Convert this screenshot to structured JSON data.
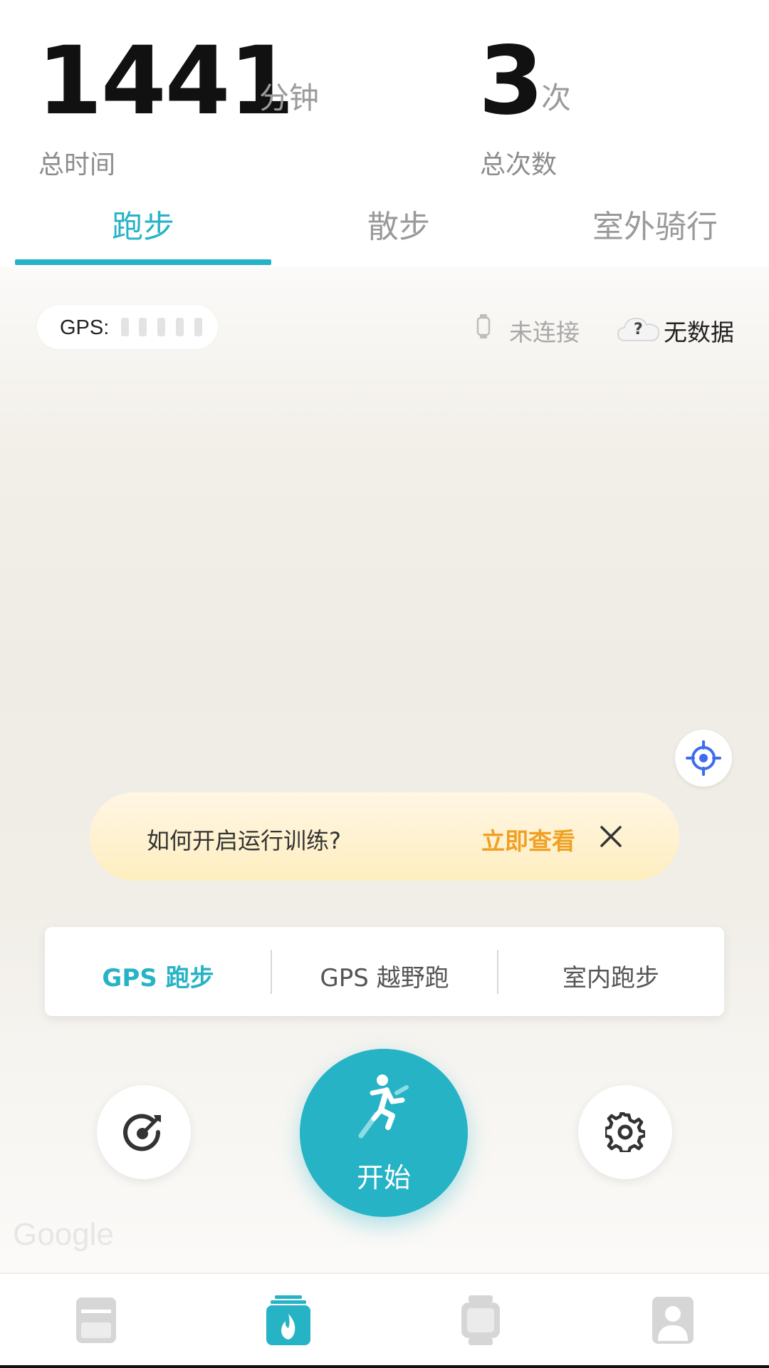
{
  "stats": {
    "total_time": {
      "value": "1441",
      "unit": "分钟",
      "label": "总时间"
    },
    "total_count": {
      "value": "3",
      "unit": "次",
      "label": "总次数"
    }
  },
  "tabs": [
    {
      "label": "跑步",
      "active": true
    },
    {
      "label": "散步",
      "active": false
    },
    {
      "label": "室外骑行",
      "active": false
    }
  ],
  "status_bar": {
    "gps_label": "GPS:",
    "device_status": "未连接",
    "weather_icon_text": "?",
    "weather_status": "无数据"
  },
  "tip": {
    "text": "如何开启运行训练?",
    "link": "立即查看"
  },
  "modes": [
    {
      "label": "GPS 跑步",
      "active": true
    },
    {
      "label": "GPS 越野跑",
      "active": false
    },
    {
      "label": "室内跑步",
      "active": false
    }
  ],
  "start_button": {
    "label": "开始"
  },
  "map_attribution": "Google",
  "colors": {
    "accent": "#27b3c6",
    "tip_link": "#f0a124",
    "locate": "#3d6cf0"
  },
  "icons": [
    "target-icon",
    "running-icon",
    "settings-gear-icon",
    "watch-icon",
    "cloud-icon",
    "locate-icon",
    "close-icon",
    "nav-records-icon",
    "nav-exercise-icon",
    "nav-device-icon",
    "nav-profile-icon"
  ]
}
